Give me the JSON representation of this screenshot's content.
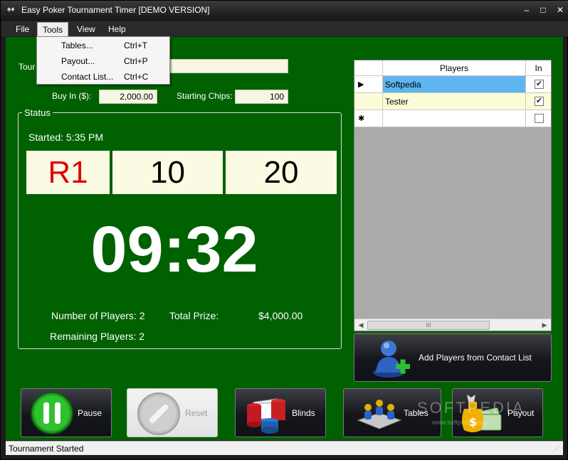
{
  "window": {
    "title": "Easy Poker Tournament Timer [DEMO VERSION]",
    "minimize": "–",
    "maximize": "□",
    "close": "✕"
  },
  "menu": {
    "file": "File",
    "tools": "Tools",
    "view": "View",
    "help": "Help"
  },
  "tools_menu": [
    {
      "label": "Tables...",
      "shortcut": "Ctrl+T"
    },
    {
      "label": "Payout...",
      "shortcut": "Ctrl+P"
    },
    {
      "label": "Contact List...",
      "shortcut": "Ctrl+C"
    }
  ],
  "form": {
    "tournament_label": "Tour",
    "tournament_value": "",
    "buy_in_label": "Buy In ($):",
    "buy_in_value": "2,000.00",
    "starting_chips_label": "Starting Chips:",
    "starting_chips_value": "100"
  },
  "status": {
    "legend": "Status",
    "started": "Started: 5:35 PM",
    "round": "R1",
    "small_blind": "10",
    "big_blind": "20",
    "clock": "09:32",
    "players_label": "Number of Players: 2",
    "total_prize_label": "Total Prize:",
    "total_prize_value": "$4,000.00",
    "remaining_label": "Remaining Players: 2"
  },
  "players_grid": {
    "col_players": "Players",
    "col_in": "In",
    "rows": [
      {
        "marker": "▶",
        "name": "Softpedia",
        "in": "✔"
      },
      {
        "marker": "",
        "name": "Tester",
        "in": "✔"
      },
      {
        "marker": "✱",
        "name": "",
        "in": ""
      }
    ],
    "scroll_grip": "III",
    "scroll_left": "◀",
    "scroll_right": "▶"
  },
  "buttons": {
    "add_players": "Add Players from Contact List",
    "pause": "Pause",
    "reset": "Reset",
    "blinds": "Blinds",
    "tables": "Tables",
    "payout": "Payout"
  },
  "statusbar": {
    "text": "Tournament Started"
  },
  "watermark": {
    "main": "SOFTPEDIA",
    "sub": "www.softpedia.com"
  },
  "colors": {
    "background_green": "#006100",
    "round_red": "#e00000",
    "selected_row": "#5fb5ef",
    "yellow_row": "#fbfbd7"
  }
}
